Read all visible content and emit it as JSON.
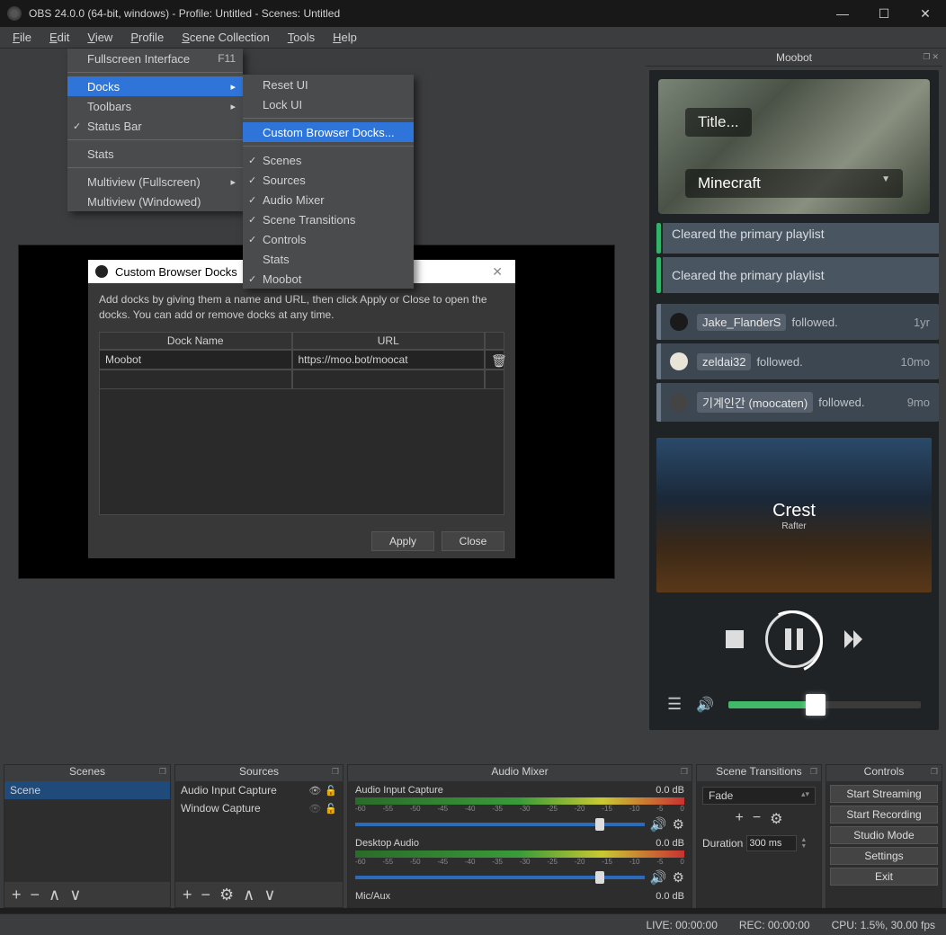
{
  "window": {
    "title": "OBS 24.0.0 (64-bit, windows) - Profile: Untitled - Scenes: Untitled"
  },
  "menubar": [
    "File",
    "Edit",
    "View",
    "Profile",
    "Scene Collection",
    "Tools",
    "Help"
  ],
  "view_menu": {
    "fullscreen": "Fullscreen Interface",
    "fullscreen_key": "F11",
    "docks": "Docks",
    "toolbars": "Toolbars",
    "statusbar": "Status Bar",
    "stats": "Stats",
    "mv_full": "Multiview (Fullscreen)",
    "mv_win": "Multiview (Windowed)"
  },
  "docks_menu": {
    "reset": "Reset UI",
    "lock": "Lock UI",
    "custom": "Custom Browser Docks...",
    "scenes": "Scenes",
    "sources": "Sources",
    "mixer": "Audio Mixer",
    "transitions": "Scene Transitions",
    "controls": "Controls",
    "stats": "Stats",
    "moobot": "Moobot"
  },
  "dialog": {
    "title": "Custom Browser Docks",
    "hint": "Add docks by giving them a name and URL, then click Apply or Close to open the docks. You can add or remove docks at any time.",
    "col_name": "Dock Name",
    "col_url": "URL",
    "row_name": "Moobot",
    "row_url": "https://moo.bot/moocat",
    "apply": "Apply",
    "close": "Close"
  },
  "moobot": {
    "title": "Moobot",
    "stream_title": "Title...",
    "stream_game": "Minecraft",
    "alert1": "Cleared the primary playlist",
    "alert2": "Cleared the primary playlist",
    "follows": [
      {
        "name": "Jake_FlanderS",
        "action": "followed.",
        "time": "1yr"
      },
      {
        "name": "zeldai32",
        "action": "followed.",
        "time": "10mo"
      },
      {
        "name": "기계인간 (moocaten)",
        "action": "followed.",
        "time": "9mo"
      }
    ],
    "song_title": "Crest",
    "song_sub": "Rafter"
  },
  "scenes": {
    "title": "Scenes",
    "items": [
      "Scene"
    ]
  },
  "sources": {
    "title": "Sources",
    "items": [
      "Audio Input Capture",
      "Window Capture"
    ]
  },
  "mixer": {
    "title": "Audio Mixer",
    "row1": "Audio Input Capture",
    "db1": "0.0 dB",
    "row2": "Desktop Audio",
    "db2": "0.0 dB",
    "row3": "Mic/Aux",
    "db3": "0.0 dB",
    "ticks": [
      "-60",
      "-55",
      "-50",
      "-45",
      "-40",
      "-35",
      "-30",
      "-25",
      "-20",
      "-15",
      "-10",
      "-5",
      "0"
    ]
  },
  "transitions": {
    "title": "Scene Transitions",
    "value": "Fade",
    "duration_label": "Duration",
    "duration": "300 ms"
  },
  "controls": {
    "title": "Controls",
    "start_stream": "Start Streaming",
    "start_rec": "Start Recording",
    "studio": "Studio Mode",
    "settings": "Settings",
    "exit": "Exit"
  },
  "status": {
    "live": "LIVE: 00:00:00",
    "rec": "REC: 00:00:00",
    "cpu": "CPU: 1.5%, 30.00 fps"
  }
}
